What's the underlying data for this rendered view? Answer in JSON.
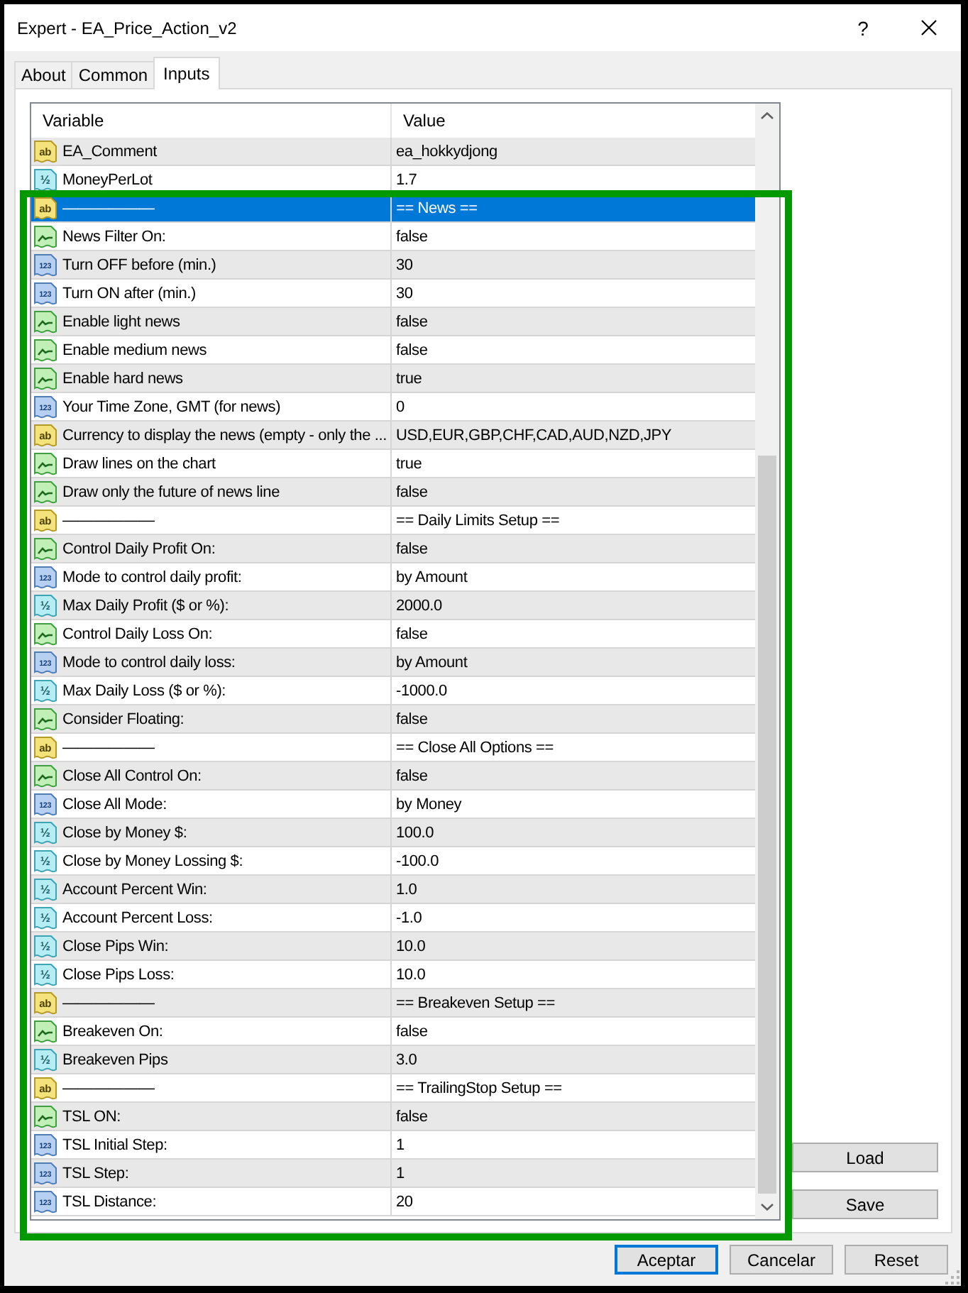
{
  "window": {
    "title": "Expert - EA_Price_Action_v2",
    "help_button": "?"
  },
  "tabs": [
    {
      "label": "About",
      "selected": false
    },
    {
      "label": "Common",
      "selected": false
    },
    {
      "label": "Inputs",
      "selected": true
    }
  ],
  "table": {
    "columns": [
      "Variable",
      "Value"
    ],
    "rows": [
      {
        "kind": "string",
        "badge": "ab",
        "variable": "EA_Comment",
        "value": "ea_hokkydjong",
        "selected": false
      },
      {
        "kind": "double",
        "badge": "½",
        "variable": "MoneyPerLot",
        "value": "1.7",
        "selected": false
      },
      {
        "kind": "string",
        "badge": "ab",
        "variable": "——————",
        "value": "== News ==",
        "selected": true
      },
      {
        "kind": "bool",
        "variable": "News Filter On:",
        "value": "false",
        "selected": false
      },
      {
        "kind": "int",
        "badge": "123",
        "variable": "Turn OFF before (min.)",
        "value": "30",
        "selected": false
      },
      {
        "kind": "int",
        "badge": "123",
        "variable": "Turn ON after (min.)",
        "value": "30",
        "selected": false
      },
      {
        "kind": "bool",
        "variable": "Enable light news",
        "value": "false",
        "selected": false
      },
      {
        "kind": "bool",
        "variable": "Enable medium news",
        "value": "false",
        "selected": false
      },
      {
        "kind": "bool",
        "variable": "Enable hard news",
        "value": "true",
        "selected": false
      },
      {
        "kind": "int",
        "badge": "123",
        "variable": "Your Time Zone, GMT (for news)",
        "value": "0",
        "selected": false
      },
      {
        "kind": "string",
        "badge": "ab",
        "variable": "Currency to display the news (empty - only the ...",
        "value": "USD,EUR,GBP,CHF,CAD,AUD,NZD,JPY",
        "selected": false
      },
      {
        "kind": "bool",
        "variable": "Draw lines on the chart",
        "value": "true",
        "selected": false
      },
      {
        "kind": "bool",
        "variable": "Draw only the future of news line",
        "value": "false",
        "selected": false
      },
      {
        "kind": "string",
        "badge": "ab",
        "variable": "——————",
        "value": "== Daily Limits Setup ==",
        "selected": false
      },
      {
        "kind": "bool",
        "variable": "Control Daily Profit On:",
        "value": "false",
        "selected": false
      },
      {
        "kind": "int",
        "badge": "123",
        "variable": "Mode to control daily profit:",
        "value": "by Amount",
        "selected": false
      },
      {
        "kind": "double",
        "badge": "½",
        "variable": "Max Daily Profit ($ or %):",
        "value": "2000.0",
        "selected": false
      },
      {
        "kind": "bool",
        "variable": "Control Daily Loss On:",
        "value": "false",
        "selected": false
      },
      {
        "kind": "int",
        "badge": "123",
        "variable": "Mode to control daily loss:",
        "value": "by Amount",
        "selected": false
      },
      {
        "kind": "double",
        "badge": "½",
        "variable": "Max Daily Loss ($ or %):",
        "value": "-1000.0",
        "selected": false
      },
      {
        "kind": "bool",
        "variable": "Consider Floating:",
        "value": "false",
        "selected": false
      },
      {
        "kind": "string",
        "badge": "ab",
        "variable": "——————",
        "value": "== Close All Options ==",
        "selected": false
      },
      {
        "kind": "bool",
        "variable": "Close All Control On:",
        "value": "false",
        "selected": false
      },
      {
        "kind": "int",
        "badge": "123",
        "variable": "Close All Mode:",
        "value": "by Money",
        "selected": false
      },
      {
        "kind": "double",
        "badge": "½",
        "variable": "Close by Money $:",
        "value": "100.0",
        "selected": false
      },
      {
        "kind": "double",
        "badge": "½",
        "variable": "Close by Money Lossing $:",
        "value": "-100.0",
        "selected": false
      },
      {
        "kind": "double",
        "badge": "½",
        "variable": "Account Percent Win:",
        "value": "1.0",
        "selected": false
      },
      {
        "kind": "double",
        "badge": "½",
        "variable": "Account Percent Loss:",
        "value": "-1.0",
        "selected": false
      },
      {
        "kind": "double",
        "badge": "½",
        "variable": "Close Pips Win:",
        "value": "10.0",
        "selected": false
      },
      {
        "kind": "double",
        "badge": "½",
        "variable": "Close Pips Loss:",
        "value": "10.0",
        "selected": false
      },
      {
        "kind": "string",
        "badge": "ab",
        "variable": "——————",
        "value": "== Breakeven Setup ==",
        "selected": false
      },
      {
        "kind": "bool",
        "variable": "Breakeven On:",
        "value": "false",
        "selected": false
      },
      {
        "kind": "double",
        "badge": "½",
        "variable": "Breakeven Pips",
        "value": "3.0",
        "selected": false
      },
      {
        "kind": "string",
        "badge": "ab",
        "variable": "——————",
        "value": "== TrailingStop Setup ==",
        "selected": false
      },
      {
        "kind": "bool",
        "variable": "TSL ON:",
        "value": "false",
        "selected": false
      },
      {
        "kind": "int",
        "badge": "123",
        "variable": "TSL Initial Step:",
        "value": "1",
        "selected": false
      },
      {
        "kind": "int",
        "badge": "123",
        "variable": "TSL Step:",
        "value": "1",
        "selected": false
      },
      {
        "kind": "int",
        "badge": "123",
        "variable": "TSL Distance:",
        "value": "20",
        "selected": false
      }
    ]
  },
  "side_buttons": [
    "Load",
    "Save"
  ],
  "buttons": [
    {
      "label": "Aceptar",
      "default": true
    },
    {
      "label": "Cancelar",
      "default": false
    },
    {
      "label": "Reset",
      "default": false
    }
  ]
}
